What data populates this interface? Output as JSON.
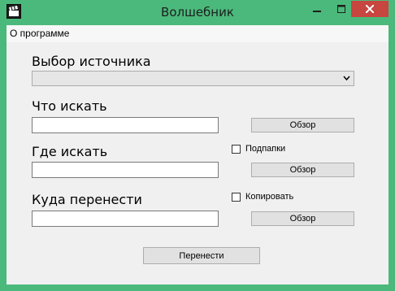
{
  "window": {
    "title": "Волшебник",
    "app_icon": "clapperboard-icon",
    "controls": [
      "minimize-icon",
      "maximize-icon",
      "close-icon"
    ]
  },
  "menu": {
    "items": [
      {
        "label": "О программе"
      }
    ]
  },
  "form": {
    "source": {
      "label": "Выбор источника",
      "selected": ""
    },
    "search": {
      "label": "Что искать",
      "value": "",
      "browse_label": "Обзор"
    },
    "location": {
      "label": "Где искать",
      "value": "",
      "subfolders_label": "Подпапки",
      "subfolders_checked": false,
      "browse_label": "Обзор"
    },
    "destination": {
      "label": "Куда перенести",
      "value": "",
      "copy_label": "Копировать",
      "copy_checked": false,
      "browse_label": "Обзор"
    },
    "submit_label": "Перенести"
  },
  "colors": {
    "titlebar": "#4bb97b",
    "close_button": "#c7463f",
    "client_bg": "#f0f0f0"
  }
}
